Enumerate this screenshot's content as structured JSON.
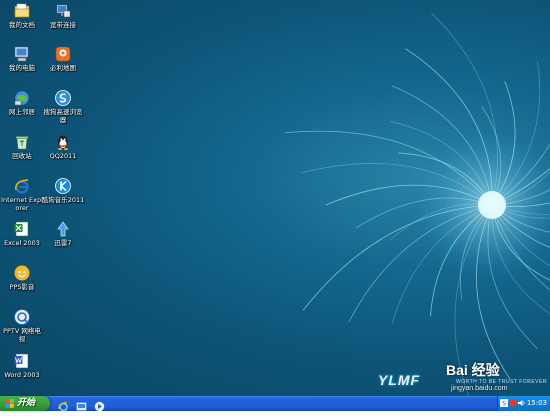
{
  "desktop": {
    "icons": [
      {
        "label": "我的文档",
        "icon": "my-documents-icon"
      },
      {
        "label": "宽带连接",
        "icon": "broadband-connection-icon"
      },
      {
        "label": "我的电脑",
        "icon": "my-computer-icon"
      },
      {
        "label": "必利地图",
        "icon": "map-icon"
      },
      {
        "label": "网上邻居",
        "icon": "network-places-icon"
      },
      {
        "label": "搜狗高速浏览器",
        "icon": "sogou-browser-icon"
      },
      {
        "label": "回收站",
        "icon": "recycle-bin-icon"
      },
      {
        "label": "QQ2011",
        "icon": "qq-icon"
      },
      {
        "label": "Internet Explorer",
        "icon": "internet-explorer-icon"
      },
      {
        "label": "酷狗音乐2011",
        "icon": "kugou-music-icon"
      },
      {
        "label": "Excel 2003",
        "icon": "excel-icon"
      },
      {
        "label": "迅雷7",
        "icon": "xunlei-icon"
      },
      {
        "label": "PPS影音",
        "icon": "pps-icon"
      },
      {
        "label": "PPTV 网络电视",
        "icon": "pptv-icon"
      },
      {
        "label": "Word 2003",
        "icon": "word-icon"
      }
    ]
  },
  "wallpaper": {
    "brand": "YLMF",
    "tagline": "WORTH TO BE TRUST FOREVER"
  },
  "watermark": {
    "baidu": "Bai 经验",
    "url": "jingyan.baidu.com"
  },
  "taskbar": {
    "start_label": "开始",
    "quick_launch": [
      "internet-explorer-icon",
      "desktop-icon",
      "media-player-icon"
    ],
    "tray_icons": [
      "language-icon",
      "security-icon",
      "network-icon",
      "volume-icon"
    ],
    "clock": "15:03"
  },
  "colors": {
    "taskbar_blue": "#245edc",
    "start_green": "#3a9c3f",
    "desktop_teal": "#14688e"
  }
}
